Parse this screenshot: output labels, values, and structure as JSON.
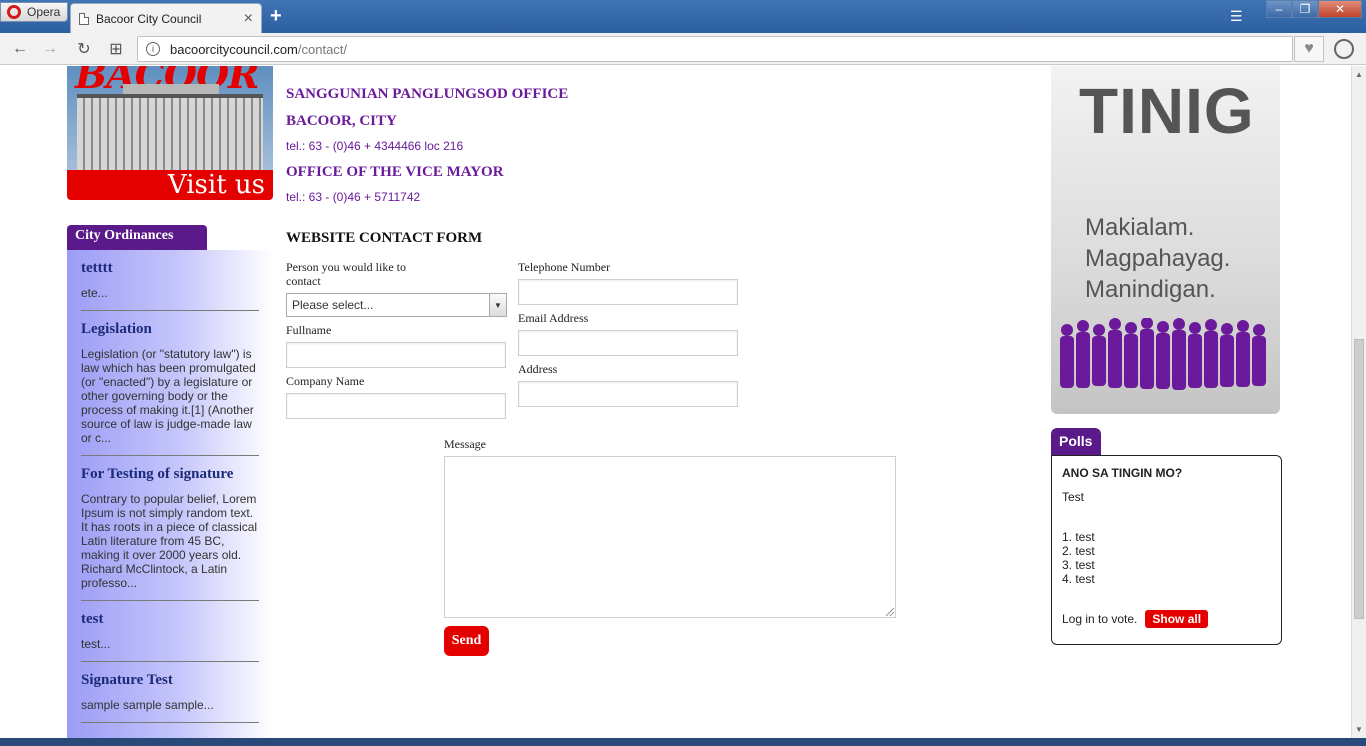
{
  "browser": {
    "menu_label": "Opera",
    "tab_title": "Bacoor City Council",
    "tab_close": "×",
    "new_tab": "+",
    "url_host": "bacoorcitycouncil.com",
    "url_path": "/contact/"
  },
  "banner": {
    "brand_text": "BACOOR",
    "visit_text": "Visit us"
  },
  "contact": {
    "office1": "SANGGUNIAN PANGLUNGSOD OFFICE",
    "city": "BACOOR, CITY",
    "tel1": "tel.: 63 - (0)46 + 4344466 loc 216",
    "office2": "OFFICE OF THE VICE MAYOR",
    "tel2": "tel.: 63 - (0)46 + 5711742"
  },
  "form": {
    "title": "WEBSITE CONTACT FORM",
    "person_label": "Person you would like to contact",
    "person_selected": "Please select...",
    "fullname_label": "Fullname",
    "company_label": "Company Name",
    "telephone_label": "Telephone Number",
    "email_label": "Email Address",
    "address_label": "Address",
    "message_label": "Message",
    "send_label": "Send"
  },
  "ordinances": {
    "header": "City Ordinances",
    "items": [
      {
        "title": "tetttt",
        "excerpt": "ete..."
      },
      {
        "title": "Legislation",
        "excerpt": "Legislation (or \"statutory law\") is law which has been promulgated (or \"enacted\") by a legislature or other governing body or the process of making it.[1] (Another source of law is judge-made law or c..."
      },
      {
        "title": "For Testing of signature",
        "excerpt": "Contrary to popular belief, Lorem Ipsum is not simply random text. It has roots in a piece of classical Latin literature from 45 BC, making it over 2000 years old. Richard McClintock, a Latin professo..."
      },
      {
        "title": "test",
        "excerpt": "test..."
      },
      {
        "title": "Signature Test",
        "excerpt": "sample sample sample..."
      }
    ]
  },
  "tinig": {
    "title": "TINIG",
    "line1": "Makialam.",
    "line2": "Magpahayag.",
    "line3": "Manindigan."
  },
  "polls": {
    "tab": "Polls",
    "question": "ANO SA TINGIN MO?",
    "subtitle": "Test",
    "options": [
      "1. test",
      "2. test",
      "3. test",
      "4. test"
    ],
    "login_text": "Log in to vote.",
    "show_all": "Show all"
  },
  "colors": {
    "accent_purple": "#5a1a8a",
    "heading_purple": "#6a1a9a",
    "button_red": "#e50000"
  }
}
